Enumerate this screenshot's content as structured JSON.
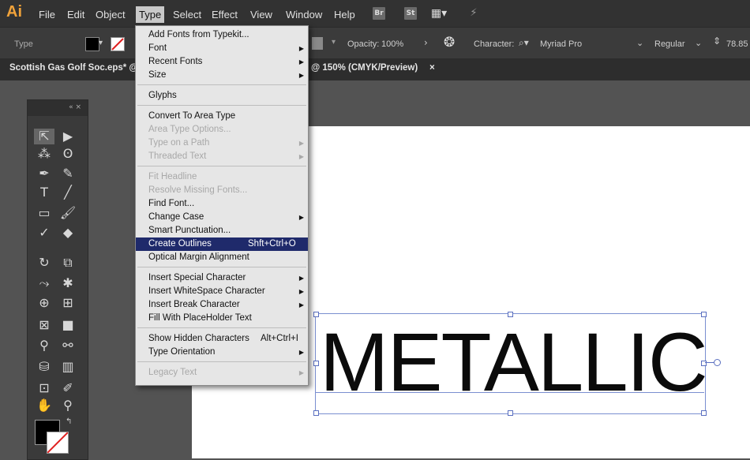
{
  "app": {
    "logo": "Ai"
  },
  "menubar": {
    "items": [
      "File",
      "Edit",
      "Object",
      "Type",
      "Select",
      "Effect",
      "View",
      "Window",
      "Help"
    ],
    "apps": [
      "Br",
      "St"
    ]
  },
  "controlbar": {
    "mode": "Type",
    "opacity_label": "Opacity:",
    "opacity_value": "100%",
    "character_label": "Character:",
    "font_family": "Myriad Pro",
    "font_style": "Regular",
    "font_size": "78.85"
  },
  "tabs": {
    "doc_left": "Scottish Gas Golf Soc.eps* @",
    "doc_right": "@ 150% (CMYK/Preview)",
    "close": "×"
  },
  "type_menu": {
    "items": [
      {
        "label": "Add Fonts from Typekit...",
        "enabled": true
      },
      {
        "label": "Font",
        "enabled": true,
        "submenu": true
      },
      {
        "label": "Recent Fonts",
        "enabled": true,
        "submenu": true
      },
      {
        "label": "Size",
        "enabled": true,
        "submenu": true
      },
      {
        "label": "Glyphs",
        "enabled": true
      },
      {
        "label": "Convert To Area Type",
        "enabled": true
      },
      {
        "label": "Area Type Options...",
        "enabled": false
      },
      {
        "label": "Type on a Path",
        "enabled": false,
        "submenu": true
      },
      {
        "label": "Threaded Text",
        "enabled": false,
        "submenu": true
      },
      {
        "label": "Fit Headline",
        "enabled": false
      },
      {
        "label": "Resolve Missing Fonts...",
        "enabled": false
      },
      {
        "label": "Find Font...",
        "enabled": true
      },
      {
        "label": "Change Case",
        "enabled": true,
        "submenu": true
      },
      {
        "label": "Smart Punctuation...",
        "enabled": true
      },
      {
        "label": "Create Outlines",
        "enabled": true,
        "shortcut": "Shft+Ctrl+O",
        "highlighted": true
      },
      {
        "label": "Optical Margin Alignment",
        "enabled": true
      },
      {
        "label": "Insert Special Character",
        "enabled": true,
        "submenu": true
      },
      {
        "label": "Insert WhiteSpace Character",
        "enabled": true,
        "submenu": true
      },
      {
        "label": "Insert Break Character",
        "enabled": true,
        "submenu": true
      },
      {
        "label": "Fill With PlaceHolder Text",
        "enabled": true
      },
      {
        "label": "Show Hidden Characters",
        "enabled": true,
        "shortcut": "Alt+Ctrl+I"
      },
      {
        "label": "Type Orientation",
        "enabled": true,
        "submenu": true
      },
      {
        "label": "Legacy Text",
        "enabled": false,
        "submenu": true
      }
    ]
  },
  "canvas": {
    "text": "METALLIC"
  },
  "colors": {
    "highlight": "#1f2a6b",
    "accent": "#f0a23a",
    "selection": "#7a8fd0"
  }
}
